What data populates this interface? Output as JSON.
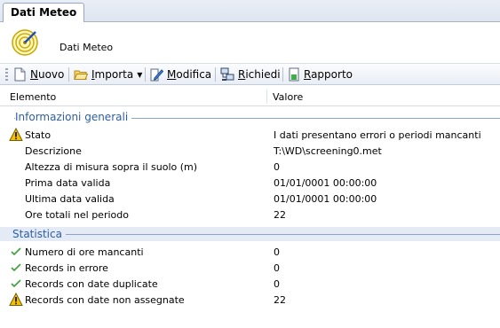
{
  "tab": {
    "label": "Dati Meteo"
  },
  "header": {
    "title": "Dati Meteo",
    "icon": "radar-target-icon"
  },
  "toolbar": {
    "items": [
      {
        "label": "Nuovo",
        "icon": "new-document-icon"
      },
      {
        "label": "Importa",
        "icon": "folder-open-icon",
        "has_dropdown": true
      },
      {
        "label": "Modifica",
        "icon": "edit-icon"
      },
      {
        "label": "Richiedi",
        "icon": "network-request-icon"
      },
      {
        "label": "Rapporto",
        "icon": "report-icon"
      }
    ]
  },
  "grid": {
    "columns": [
      "Elemento",
      "Valore"
    ],
    "groups": [
      {
        "title": "Informazioni generali",
        "rows": [
          {
            "name": "Stato",
            "value": "I dati presentano errori o periodi mancanti",
            "status": "warning"
          },
          {
            "name": "Descrizione",
            "value": "T:\\WD\\screening0.met",
            "status": "none"
          },
          {
            "name": "Altezza di misura sopra il suolo (m)",
            "value": "0",
            "status": "none"
          },
          {
            "name": "Prima data valida",
            "value": "01/01/0001 00:00:00",
            "status": "none"
          },
          {
            "name": "Ultima data valida",
            "value": "01/01/0001 00:00:00",
            "status": "none"
          },
          {
            "name": "Ore totali nel periodo",
            "value": "22",
            "status": "none"
          }
        ]
      },
      {
        "title": "Statistica",
        "rows": [
          {
            "name": "Numero di ore mancanti",
            "value": "0",
            "status": "ok"
          },
          {
            "name": "Records in errore",
            "value": "0",
            "status": "ok"
          },
          {
            "name": "Records con date duplicate",
            "value": "0",
            "status": "ok"
          },
          {
            "name": "Records con date non assegnate",
            "value": "22",
            "status": "warning"
          }
        ]
      }
    ]
  },
  "colors": {
    "group_title": "#2c5ea8",
    "warning": "#f2c200",
    "ok": "#3aa23a"
  }
}
